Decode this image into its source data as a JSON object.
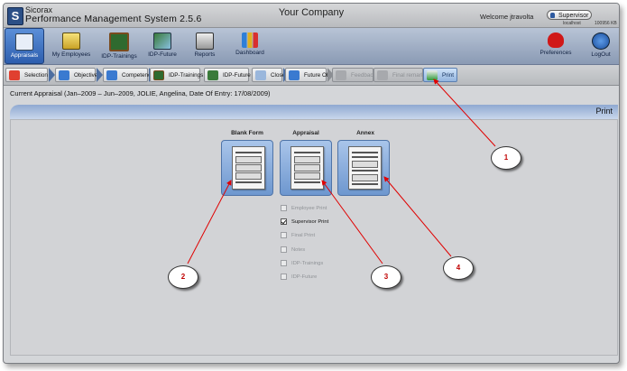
{
  "app": {
    "vendor": "Sicorax",
    "title": "Performance Management System 2.5.6",
    "company": "Your Company",
    "welcome": "Welcome jtravolta",
    "role": "Supervisor",
    "host": "localhost",
    "memory": "100956 KB"
  },
  "toolbar": {
    "items": [
      {
        "label": "Appraisals",
        "icon": "appraisals-icon"
      },
      {
        "label": "My Employees",
        "icon": "employees-icon"
      },
      {
        "label": "IDP-Trainings",
        "icon": "chalkboard-icon"
      },
      {
        "label": "IDP-Future",
        "icon": "future-icon"
      },
      {
        "label": "Reports",
        "icon": "printer-icon"
      },
      {
        "label": "Dashboard",
        "icon": "bar-chart-icon"
      }
    ],
    "right_items": [
      {
        "label": "Preferences",
        "icon": "heart-icon"
      },
      {
        "label": "LogOut",
        "icon": "power-icon"
      }
    ]
  },
  "tabs": [
    {
      "label": "Selection"
    },
    {
      "label": "Objectives"
    },
    {
      "label": "Competencies"
    },
    {
      "label": "IDP-Trainings"
    },
    {
      "label": "IDP-Future"
    },
    {
      "label": "Close"
    },
    {
      "label": "Future Obj."
    },
    {
      "label": "Feedback"
    },
    {
      "label": "Final remarks"
    },
    {
      "label": "Print"
    }
  ],
  "current_appraisal": "Current Appraisal (Jan–2009 – Jun–2009, JOLIE, Angelina, Date Of Entry: 17/08/2009)",
  "panel": {
    "title": "Print",
    "buttons": [
      {
        "label": "Blank Form"
      },
      {
        "label": "Appraisal"
      },
      {
        "label": "Annex"
      }
    ],
    "options": [
      {
        "label": "Employee Print",
        "checked": false
      },
      {
        "label": "Supervisor Print",
        "checked": true
      },
      {
        "label": "Final Print",
        "checked": false
      },
      {
        "label": "Notes",
        "checked": false
      },
      {
        "label": "IDP-Trainings",
        "checked": false
      },
      {
        "label": "IDP-Future",
        "checked": false
      }
    ]
  },
  "callouts": [
    "1",
    "2",
    "3",
    "4"
  ],
  "colors": {
    "accent": "#2d5eae",
    "annotation": "#e00000"
  }
}
